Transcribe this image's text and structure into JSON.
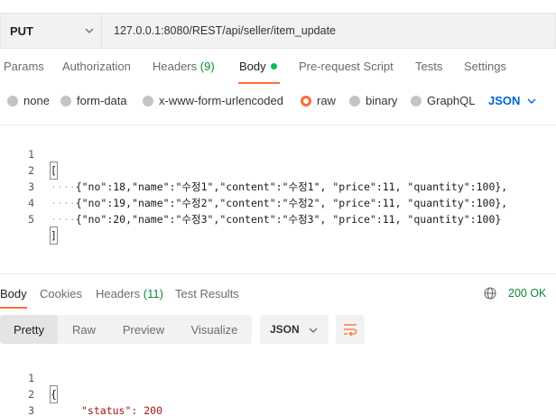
{
  "request": {
    "method": "PUT",
    "url": "127.0.0.1:8080/REST/api/seller/item_update"
  },
  "request_tabs": [
    {
      "label": "Params"
    },
    {
      "label": "Authorization"
    },
    {
      "label": "Headers",
      "count": "(9)"
    },
    {
      "label": "Body"
    },
    {
      "label": "Pre-request Script"
    },
    {
      "label": "Tests"
    },
    {
      "label": "Settings"
    }
  ],
  "body_types": [
    "none",
    "form-data",
    "x-www-form-urlencoded",
    "raw",
    "binary",
    "GraphQL"
  ],
  "body_type_selected": "raw",
  "body_format": "JSON",
  "editor": {
    "line_numbers": [
      "1",
      "2",
      "3",
      "4",
      "5"
    ],
    "lines": [
      "[",
      "{\"no\":18,\"name\":\"수정1\",\"content\":\"수정1\", \"price\":11, \"quantity\":100},",
      "{\"no\":19,\"name\":\"수정2\",\"content\":\"수정2\", \"price\":11, \"quantity\":100},",
      "{\"no\":20,\"name\":\"수정3\",\"content\":\"수정3\", \"price\":11, \"quantity\":100}",
      "]"
    ]
  },
  "response_tabs": [
    {
      "label": "Body"
    },
    {
      "label": "Cookies"
    },
    {
      "label": "Headers",
      "count": "(11)"
    },
    {
      "label": "Test Results"
    }
  ],
  "response_status": "200 OK",
  "response_views": [
    "Pretty",
    "Raw",
    "Preview",
    "Visualize"
  ],
  "response_format": "JSON",
  "response": {
    "line_numbers": [
      "1",
      "2",
      "3"
    ],
    "lines": [
      "{",
      "\"status\": 200",
      "}"
    ]
  },
  "colors": {
    "accent": "#ff6c37",
    "success": "#0c8a3a",
    "link": "#0265d2"
  }
}
